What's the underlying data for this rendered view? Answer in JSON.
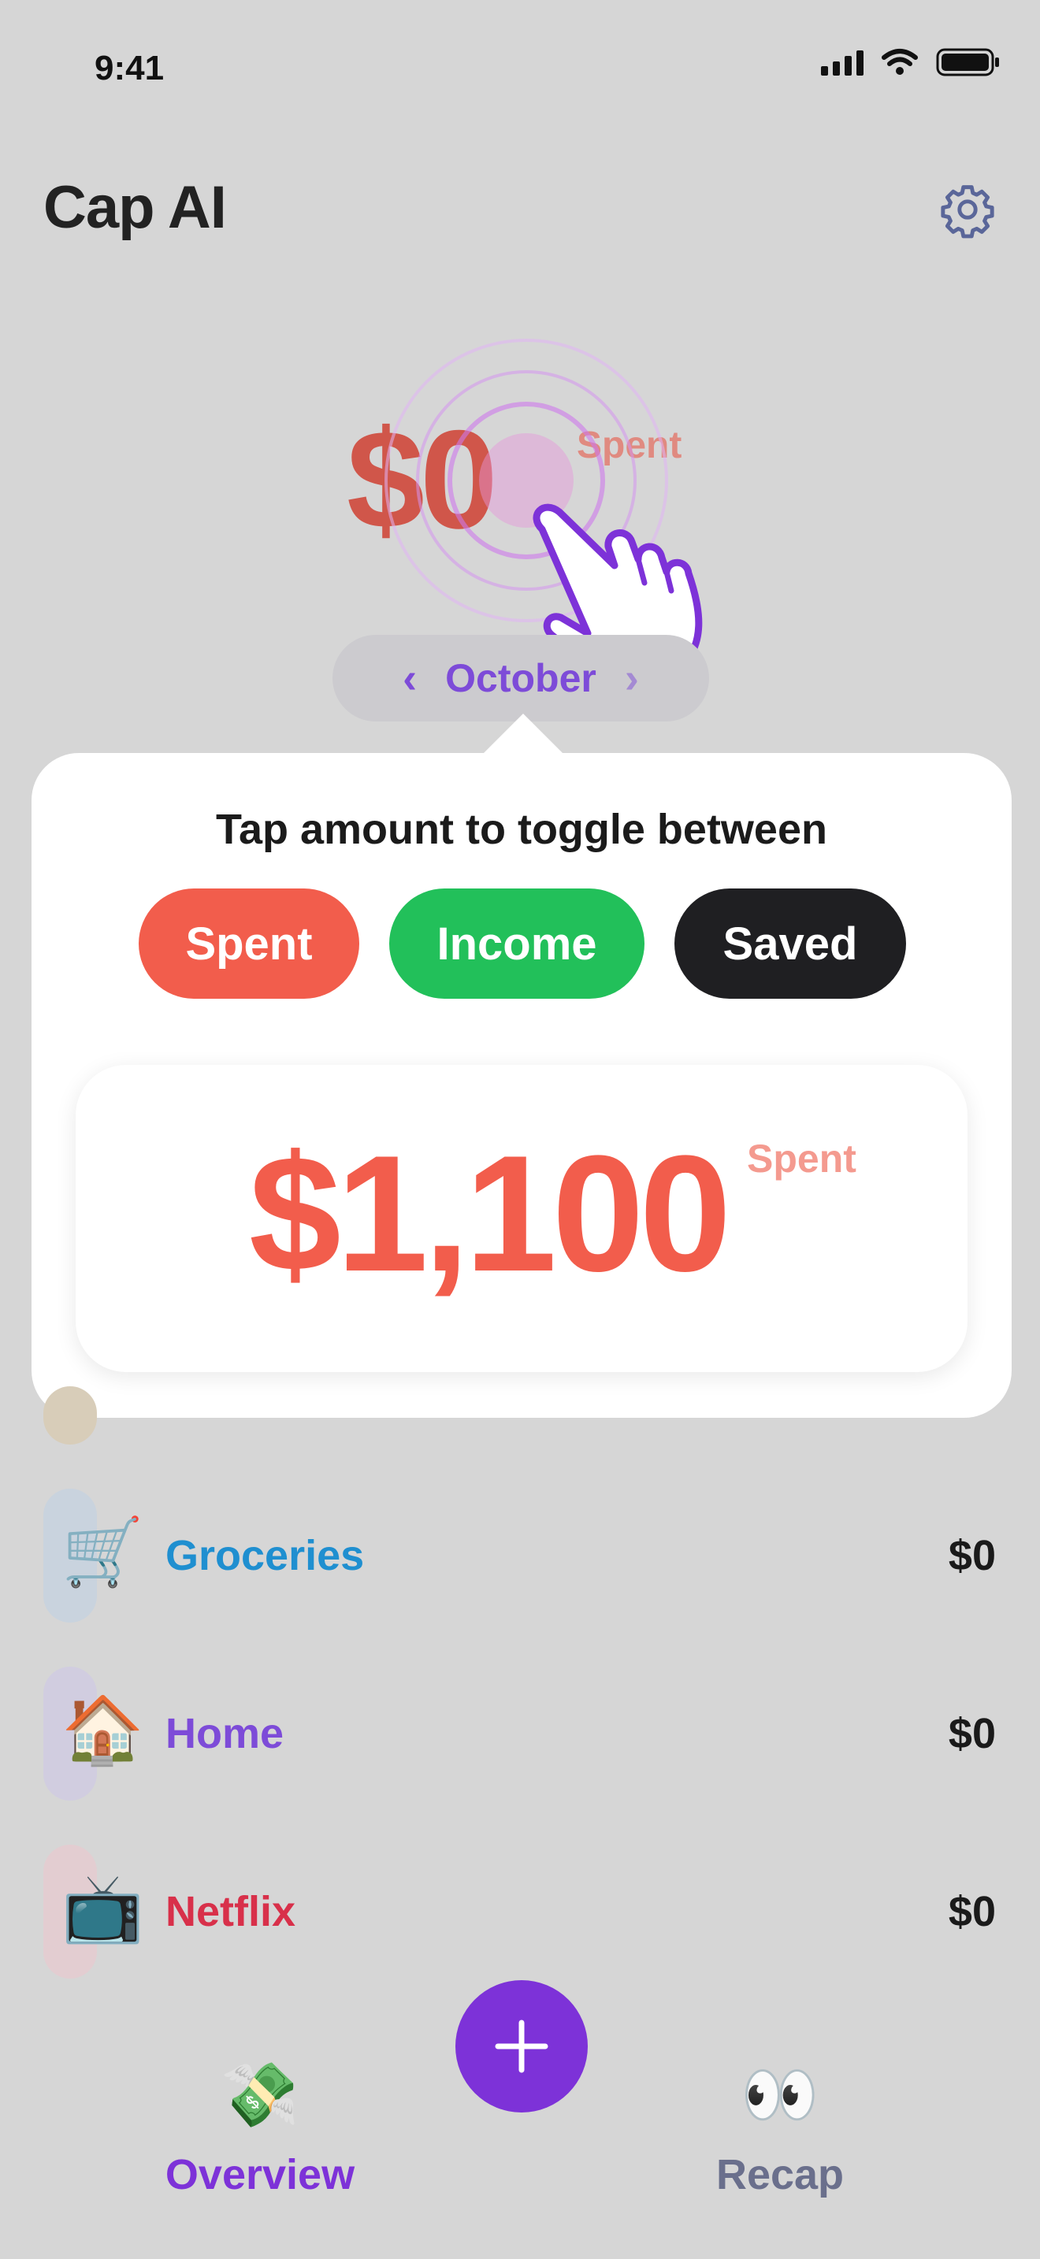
{
  "status_bar": {
    "time": "9:41"
  },
  "header": {
    "title": "Cap AI",
    "settings_icon": "gear-icon"
  },
  "summary": {
    "amount": "$0",
    "mode_label": "Spent"
  },
  "month_picker": {
    "month": "October",
    "prev_icon": "chevron-left-icon",
    "next_icon": "chevron-right-icon"
  },
  "popup": {
    "title": "Tap amount to toggle between",
    "toggles": [
      {
        "label": "Spent",
        "color": "#f25d4c"
      },
      {
        "label": "Income",
        "color": "#22c05a"
      },
      {
        "label": "Saved",
        "color": "#1f1f22"
      }
    ],
    "example_amount": "$1,100",
    "example_label": "Spent"
  },
  "categories": [
    {
      "emoji": "🛒",
      "icon": "shopping-cart-icon",
      "name": "Groceries",
      "amount": "$0",
      "color": "#1f8fd0"
    },
    {
      "emoji": "🏠",
      "icon": "house-icon",
      "name": "Home",
      "amount": "$0",
      "color": "#7d4bd8"
    },
    {
      "emoji": "📺",
      "icon": "television-icon",
      "name": "Netflix",
      "amount": "$0",
      "color": "#d8304a"
    }
  ],
  "bottom_nav": {
    "overview": {
      "emoji": "💸",
      "icon": "money-with-wings-icon",
      "label": "Overview",
      "color": "#7d32d8"
    },
    "recap": {
      "emoji": "👀",
      "icon": "eyes-icon",
      "label": "Recap",
      "color": "#6a6f8c"
    },
    "add_icon": "plus-icon"
  },
  "colors": {
    "accent": "#7d32d8",
    "spent": "#f25d4c",
    "income": "#22c05a",
    "saved": "#1f1f22"
  }
}
